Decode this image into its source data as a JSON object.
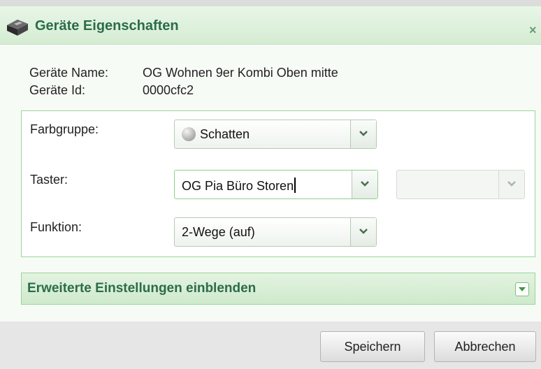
{
  "dialog": {
    "title": "Geräte Eigenschaften",
    "close_glyph": "×",
    "icon": "device-icon"
  },
  "device": {
    "name_label": "Geräte Name:",
    "name_value": "OG Wohnen 9er Kombi Oben mitte",
    "id_label": "Geräte Id:",
    "id_value": "0000cfc2"
  },
  "form": {
    "farbgruppe_label": "Farbgruppe:",
    "farbgruppe_value": "Schatten",
    "farbgruppe_icon": "gray-circle-icon",
    "taster_label": "Taster:",
    "taster_value": "OG Pia Büro Storen",
    "taster_secondary_value": "",
    "funktion_label": "Funktion:",
    "funktion_value": "2-Wege (auf)"
  },
  "advanced": {
    "label": "Erweiterte Einstellungen einblenden"
  },
  "buttons": {
    "save": "Speichern",
    "cancel": "Abbrechen"
  },
  "colors": {
    "accent_green": "#2c6c4a",
    "border_green": "#9cd49a",
    "header_bg": "#d4ecd2",
    "trigger_arrow": "#4d6e52"
  }
}
